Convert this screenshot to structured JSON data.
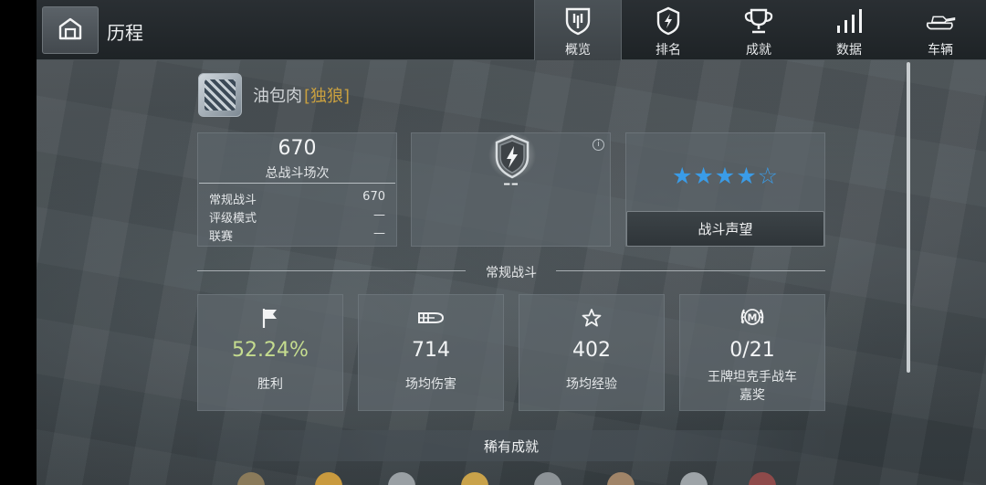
{
  "header": {
    "title": "历程",
    "home_icon": "garage-icon",
    "tabs": [
      {
        "label": "概览",
        "icon": "shield-icon",
        "active": true
      },
      {
        "label": "排名",
        "icon": "lightning-shield-icon",
        "active": false
      },
      {
        "label": "成就",
        "icon": "trophy-icon",
        "active": false
      },
      {
        "label": "数据",
        "icon": "bar-chart-icon",
        "active": false
      },
      {
        "label": "车辆",
        "icon": "tank-icon",
        "active": false
      }
    ]
  },
  "player": {
    "name": "油包肉",
    "clan_tag": "[独狼]"
  },
  "battles": {
    "total": "670",
    "label": "总战斗场次",
    "modes": [
      {
        "name": "常规战斗",
        "value": "670"
      },
      {
        "name": "评级模式",
        "value": "—"
      },
      {
        "name": "联赛",
        "value": "—"
      }
    ]
  },
  "rank": {
    "value": "--"
  },
  "karma": {
    "stars_filled": 4,
    "stars_total": 5,
    "star_color": "#3a9ce8",
    "button_label": "战斗声望"
  },
  "section": {
    "title": "常规战斗"
  },
  "stats": [
    {
      "icon": "flag-icon",
      "value": "52.24%",
      "label": "胜利",
      "value_color": "#c5dc8f"
    },
    {
      "icon": "shell-icon",
      "value": "714",
      "label": "场均伤害"
    },
    {
      "icon": "star-icon",
      "value": "402",
      "label": "场均经验"
    },
    {
      "icon": "mastery-badge-icon",
      "value": "0/21",
      "label_line1": "王牌坦克手战车",
      "label_line2": "嘉奖"
    }
  ],
  "rare": {
    "title": "稀有成就"
  }
}
